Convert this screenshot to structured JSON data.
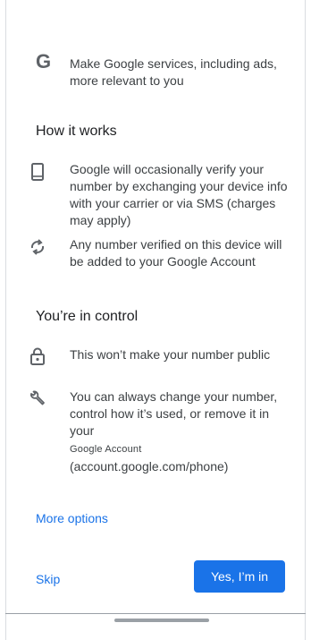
{
  "intro": {
    "logo_letter": "G",
    "text": "Make Google services, including ads, more relevant to you"
  },
  "how_it_works": {
    "heading": "How it works",
    "items": [
      {
        "icon": "phone-icon",
        "text": "Google will occasionally verify your number by exchanging your device info with your carrier or via SMS (charges may apply)"
      },
      {
        "icon": "sync-icon",
        "text": "Any number verified on this device will be added to your Google Account"
      }
    ]
  },
  "in_control": {
    "heading": "You’re in control",
    "items": [
      {
        "icon": "lock-icon",
        "text": "This won’t make your number public"
      },
      {
        "icon": "wrench-icon",
        "text_main": "You can always change your number, control how it’s used, or remove it in your",
        "text_account": "Google Account",
        "text_url": "(account.google.com/phone)"
      }
    ]
  },
  "actions": {
    "more_options": "More options",
    "skip": "Skip",
    "confirm": "Yes, I’m in"
  },
  "colors": {
    "accent": "#1a73e8",
    "icon": "#5f6368",
    "text": "#3c4043"
  }
}
